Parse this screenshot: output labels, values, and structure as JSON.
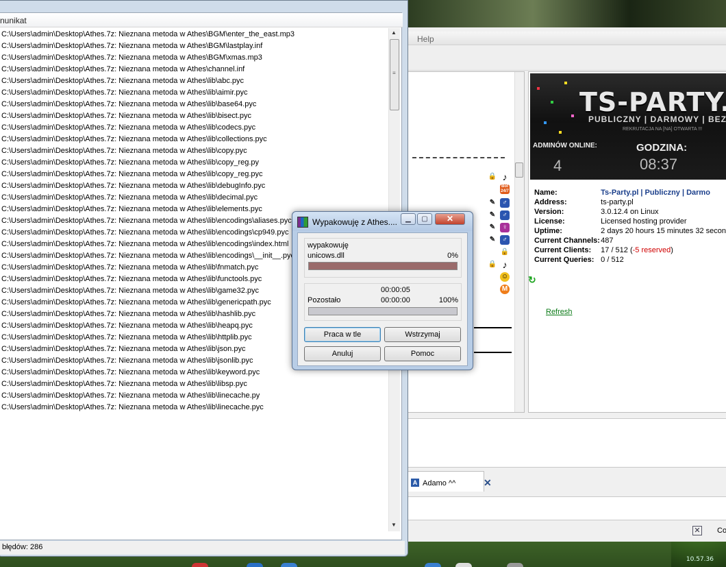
{
  "teamspeak": {
    "menu_help": "Help",
    "banner": {
      "title": "TS-PARTY.P",
      "subtitle": "PUBLICZNY | DARMOWY | BEZPIECZ",
      "recruitment": "REKRUTACJA NA [NA] OTWARTA !!!",
      "admins_label": "ADMINÓW ONLINE:",
      "admins_count": "4",
      "clock_label": "GODZINA:",
      "clock_value": "08:37"
    },
    "info": {
      "name_label": "Name:",
      "name_value": "Ts-Party.pl | Publiczny | Darmo",
      "address_label": "Address:",
      "address_value": "ts-party.pl",
      "version_label": "Version:",
      "version_value": "3.0.12.4 on Linux",
      "license_label": "License:",
      "license_value": "Licensed hosting provider",
      "uptime_label": "Uptime:",
      "uptime_value": "2 days 20 hours 15 minutes 32 secon",
      "channels_label": "Current Channels:",
      "channels_value": "487",
      "clients_label": "Current Clients:",
      "clients_value": "17 / 512 (",
      "clients_reserved": "-5 reserved",
      "clients_close": ")",
      "queries_label": "Current Queries:",
      "queries_value": "0 / 512"
    },
    "refresh_label": "Refresh",
    "chat_tab_label": "Adamo ^^",
    "status_text": "Co",
    "badge_label": "Bot 24/7"
  },
  "error_window": {
    "column_header": "nunikat",
    "status_text": "błędów: 286",
    "items": [
      "C:\\Users\\admin\\Desktop\\Athes.7z: Nieznana metoda w Athes\\BGM\\enter_the_east.mp3",
      "C:\\Users\\admin\\Desktop\\Athes.7z: Nieznana metoda w Athes\\BGM\\lastplay.inf",
      "C:\\Users\\admin\\Desktop\\Athes.7z: Nieznana metoda w Athes\\BGM\\xmas.mp3",
      "C:\\Users\\admin\\Desktop\\Athes.7z: Nieznana metoda w Athes\\channel.inf",
      "C:\\Users\\admin\\Desktop\\Athes.7z: Nieznana metoda w Athes\\lib\\abc.pyc",
      "C:\\Users\\admin\\Desktop\\Athes.7z: Nieznana metoda w Athes\\lib\\aimir.pyc",
      "C:\\Users\\admin\\Desktop\\Athes.7z: Nieznana metoda w Athes\\lib\\base64.pyc",
      "C:\\Users\\admin\\Desktop\\Athes.7z: Nieznana metoda w Athes\\lib\\bisect.pyc",
      "C:\\Users\\admin\\Desktop\\Athes.7z: Nieznana metoda w Athes\\lib\\codecs.pyc",
      "C:\\Users\\admin\\Desktop\\Athes.7z: Nieznana metoda w Athes\\lib\\collections.pyc",
      "C:\\Users\\admin\\Desktop\\Athes.7z: Nieznana metoda w Athes\\lib\\copy.pyc",
      "C:\\Users\\admin\\Desktop\\Athes.7z: Nieznana metoda w Athes\\lib\\copy_reg.py",
      "C:\\Users\\admin\\Desktop\\Athes.7z: Nieznana metoda w Athes\\lib\\copy_reg.pyc",
      "C:\\Users\\admin\\Desktop\\Athes.7z: Nieznana metoda w Athes\\lib\\debugInfo.pyc",
      "C:\\Users\\admin\\Desktop\\Athes.7z: Nieznana metoda w Athes\\lib\\decimal.pyc",
      "C:\\Users\\admin\\Desktop\\Athes.7z: Nieznana metoda w Athes\\lib\\elements.pyc",
      "C:\\Users\\admin\\Desktop\\Athes.7z: Nieznana metoda w Athes\\lib\\encodings\\aliases.pyc",
      "C:\\Users\\admin\\Desktop\\Athes.7z: Nieznana metoda w Athes\\lib\\encodings\\cp949.pyc",
      "C:\\Users\\admin\\Desktop\\Athes.7z: Nieznana metoda w Athes\\lib\\encodings\\index.html",
      "C:\\Users\\admin\\Desktop\\Athes.7z: Nieznana metoda w Athes\\lib\\encodings\\__init__.pyc",
      "C:\\Users\\admin\\Desktop\\Athes.7z: Nieznana metoda w Athes\\lib\\fnmatch.pyc",
      "C:\\Users\\admin\\Desktop\\Athes.7z: Nieznana metoda w Athes\\lib\\functools.pyc",
      "C:\\Users\\admin\\Desktop\\Athes.7z: Nieznana metoda w Athes\\lib\\game32.pyc",
      "C:\\Users\\admin\\Desktop\\Athes.7z: Nieznana metoda w Athes\\lib\\genericpath.pyc",
      "C:\\Users\\admin\\Desktop\\Athes.7z: Nieznana metoda w Athes\\lib\\hashlib.pyc",
      "C:\\Users\\admin\\Desktop\\Athes.7z: Nieznana metoda w Athes\\lib\\heapq.pyc",
      "C:\\Users\\admin\\Desktop\\Athes.7z: Nieznana metoda w Athes\\lib\\httplib.pyc",
      "C:\\Users\\admin\\Desktop\\Athes.7z: Nieznana metoda w Athes\\lib\\json.pyc",
      "C:\\Users\\admin\\Desktop\\Athes.7z: Nieznana metoda w Athes\\lib\\jsonlib.pyc",
      "C:\\Users\\admin\\Desktop\\Athes.7z: Nieznana metoda w Athes\\lib\\keyword.pyc",
      "C:\\Users\\admin\\Desktop\\Athes.7z: Nieznana metoda w Athes\\lib\\libsp.pyc",
      "C:\\Users\\admin\\Desktop\\Athes.7z: Nieznana metoda w Athes\\lib\\linecache.py",
      "C:\\Users\\admin\\Desktop\\Athes.7z: Nieznana metoda w Athes\\lib\\linecache.pyc"
    ]
  },
  "progress_dialog": {
    "title": "Wypakowuję z Athes....",
    "action_label": "wypakowuję",
    "current_file": "unicows.dll",
    "file_percent": "0%",
    "file_progress_fraction": 0.0,
    "elapsed_time": "00:00:05",
    "remaining_label": "Pozostało",
    "remaining_time": "00:00:00",
    "total_percent": "100%",
    "total_progress_fraction": 1.0,
    "buttons": {
      "background": "Praca w tle",
      "pause": "Wstrzymaj",
      "cancel": "Anuluj",
      "help": "Pomoc"
    }
  },
  "clock": {
    "time": "10.57.36"
  },
  "colors": {
    "file_bar": "#9a6b6b",
    "total_bar": "#c9c9cf",
    "ts_name_link": "#1b3f8b",
    "reserved_red": "#d00000",
    "refresh_green": "#0a7a16"
  }
}
